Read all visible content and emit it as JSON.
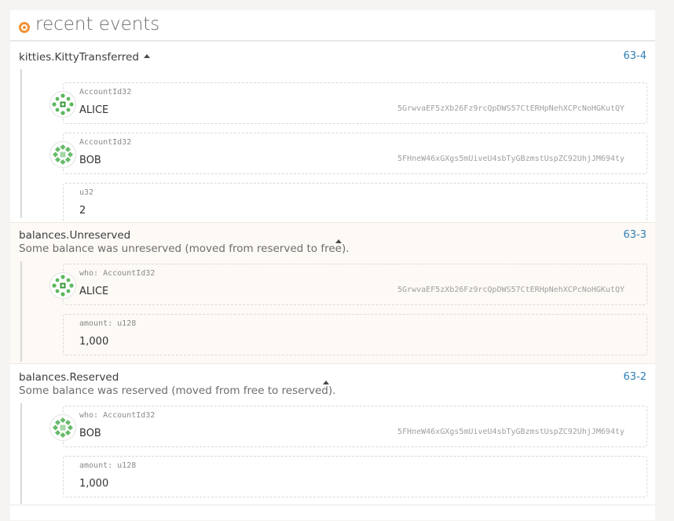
{
  "header": {
    "title": "recent events"
  },
  "events": [
    {
      "title": "kitties.KittyTransferred",
      "description": "",
      "id": "63-4",
      "params": [
        {
          "label": "AccountId32",
          "value": "ALICE",
          "address": "5GrwvaEF5zXb26Fz9rcQpDWS57CtERHpNehXCPcNoHGKutQY",
          "identicon": "alice-identicon"
        },
        {
          "label": "AccountId32",
          "value": "BOB",
          "address": "5FHneW46xGXgs5mUiveU4sbTyGBzmstUspZC92UhjJM694ty",
          "identicon": "bob-identicon"
        },
        {
          "label": "u32",
          "value": "2",
          "address": ""
        }
      ]
    },
    {
      "title": "balances.Unreserved",
      "description": "Some balance was unreserved (moved from reserved to free).",
      "id": "63-3",
      "params": [
        {
          "label": "who: AccountId32",
          "value": "ALICE",
          "address": "5GrwvaEF5zXb26Fz9rcQpDWS57CtERHpNehXCPcNoHGKutQY",
          "identicon": "alice-identicon"
        },
        {
          "label": "amount: u128",
          "value": "1,000",
          "address": ""
        }
      ]
    },
    {
      "title": "balances.Reserved",
      "description": "Some balance was reserved (moved from free to reserved).",
      "id": "63-2",
      "params": [
        {
          "label": "who: AccountId32",
          "value": "BOB",
          "address": "5FHneW46xGXgs5mUiveU4sbTyGBzmstUspZC92UhjJM694ty",
          "identicon": "bob-identicon"
        },
        {
          "label": "amount: u128",
          "value": "1,000",
          "address": ""
        }
      ]
    }
  ],
  "colors": {
    "accent": "#f19135",
    "link": "#2f7fb5",
    "identicon_green": "#4caf50"
  }
}
